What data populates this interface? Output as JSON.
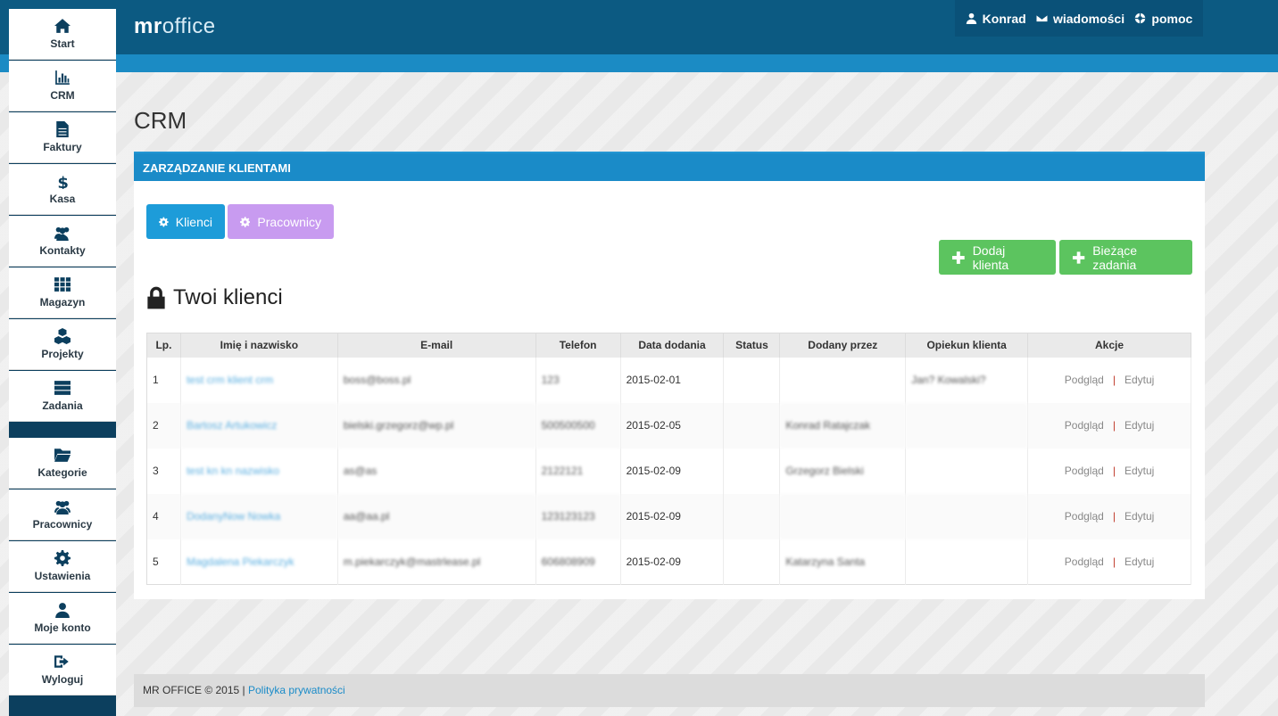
{
  "brand": {
    "part1": "mr",
    "part2": "office"
  },
  "topnav": [
    {
      "label": "Konrad",
      "icon": "user-icon"
    },
    {
      "label": "wiadomości",
      "icon": "envelope-icon"
    },
    {
      "label": "pomoc",
      "icon": "lifebuoy-icon"
    }
  ],
  "sidebar": {
    "items": [
      {
        "label": "Start",
        "icon": "home-icon"
      },
      {
        "label": "CRM",
        "icon": "chart-icon"
      },
      {
        "label": "Faktury",
        "icon": "file-icon"
      },
      {
        "label": "Kasa",
        "icon": "dollar-icon"
      },
      {
        "label": "Kontakty",
        "icon": "users-icon"
      },
      {
        "label": "Magazyn",
        "icon": "grid-icon"
      },
      {
        "label": "Projekty",
        "icon": "cubes-icon"
      },
      {
        "label": "Zadania",
        "icon": "tasks-icon"
      },
      {
        "label": "Kategorie",
        "icon": "folder-icon"
      },
      {
        "label": "Pracownicy",
        "icon": "users-icon"
      },
      {
        "label": "Ustawienia",
        "icon": "gear-icon"
      },
      {
        "label": "Moje konto",
        "icon": "user-icon"
      },
      {
        "label": "Wyloguj",
        "icon": "logout-icon"
      }
    ]
  },
  "page": {
    "title": "CRM"
  },
  "panel": {
    "heading": "ZARZĄDZANIE KLIENTAMI",
    "tab_clients": "Klienci",
    "tab_workers": "Pracownicy",
    "add_client": "Dodaj klienta",
    "current_tasks": "Bieżące zadania",
    "section_title": "Twoi klienci"
  },
  "table": {
    "headers": [
      "Lp.",
      "Imię i nazwisko",
      "E-mail",
      "Telefon",
      "Data dodania",
      "Status",
      "Dodany przez",
      "Opiekun klienta",
      "Akcje"
    ],
    "rows": [
      {
        "lp": "1",
        "name": "test crm klient crm",
        "email": "boss@boss.pl",
        "phone": "123",
        "date": "2015-02-01",
        "status": "",
        "added_by": "",
        "keeper": "Jan? Kowalski?",
        "view": "Podgląd",
        "edit": "Edytuj"
      },
      {
        "lp": "2",
        "name": "Bartosz Artukowicz",
        "email": "bielski.grzegorz@wp.pl",
        "phone": "500500500",
        "date": "2015-02-05",
        "status": "",
        "added_by": "Konrad Ratajczak",
        "keeper": "",
        "view": "Podgląd",
        "edit": "Edytuj"
      },
      {
        "lp": "3",
        "name": "test kn kn nazwisko",
        "email": "as@as",
        "phone": "2122121",
        "date": "2015-02-09",
        "status": "",
        "added_by": "Grzegorz Bielski",
        "keeper": "",
        "view": "Podgląd",
        "edit": "Edytuj"
      },
      {
        "lp": "4",
        "name": "DodanyNow Nowka",
        "email": "aa@aa.pl",
        "phone": "123123123",
        "date": "2015-02-09",
        "status": "",
        "added_by": "",
        "keeper": "",
        "view": "Podgląd",
        "edit": "Edytuj"
      },
      {
        "lp": "5",
        "name": "Magdalena Piekarczyk",
        "email": "m.piekarczyk@mastrlease.pl",
        "phone": "606808909",
        "date": "2015-02-09",
        "status": "",
        "added_by": "Katarzyna Santa",
        "keeper": "",
        "view": "Podgląd",
        "edit": "Edytuj"
      }
    ]
  },
  "footer": {
    "copyright": "MR OFFICE © 2015 |",
    "privacy": "Polityka prywatności"
  }
}
